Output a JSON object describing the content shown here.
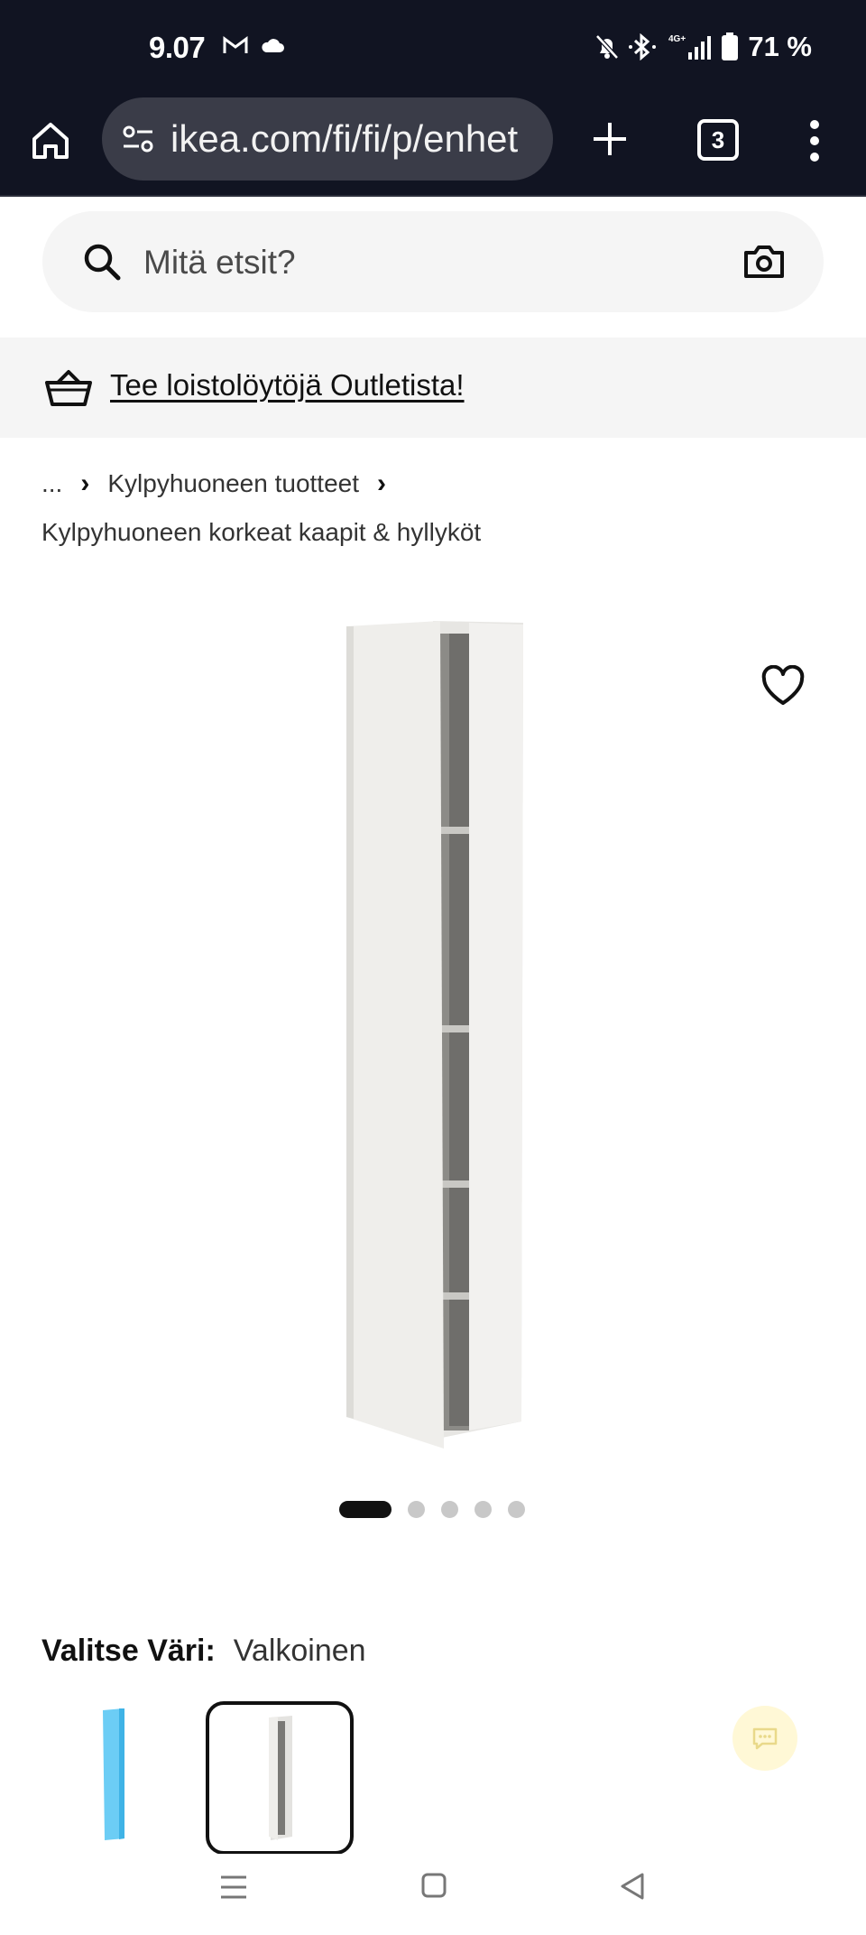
{
  "status_bar": {
    "time": "9.07",
    "battery_text": "71 %",
    "network": "4G+",
    "icons": [
      "gmail-icon",
      "cloud-icon",
      "mute-icon",
      "bluetooth-icon",
      "signal-icon",
      "battery-icon"
    ]
  },
  "browser": {
    "url": "ikea.com/fi/fi/p/enhet",
    "tab_count": "3",
    "icons": [
      "home-icon",
      "site-settings-icon",
      "new-tab-icon",
      "tabs-icon",
      "menu-icon"
    ]
  },
  "search": {
    "placeholder": "Mitä etsit?"
  },
  "banner": {
    "text": "Tee loistolöytöjä Outletista!"
  },
  "breadcrumb": {
    "ellipsis": "...",
    "parent": "Kylpyhuoneen tuotteet",
    "current": "Kylpyhuoneen korkeat kaapit & hyllyköt"
  },
  "gallery": {
    "image_count": 5,
    "active_index": 0
  },
  "variant": {
    "label": "Valitse Väri:",
    "value": "Valkoinen",
    "options": [
      "light-blue",
      "white"
    ],
    "selected": "white"
  },
  "colors": {
    "status_bg": "#111422",
    "url_bg": "#3a3c48",
    "surface": "#f5f5f5",
    "swatch_blue": "#6ccdf5"
  }
}
